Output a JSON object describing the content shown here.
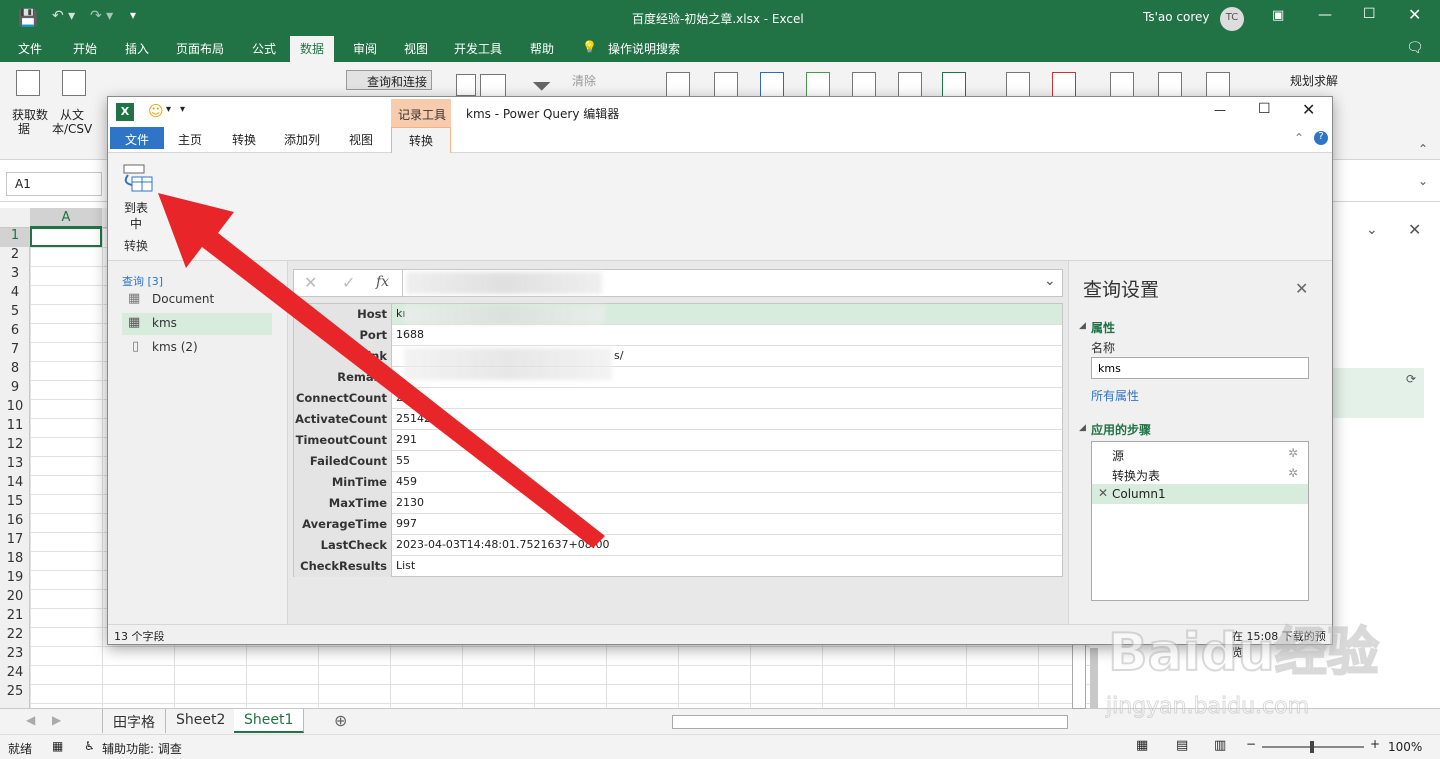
{
  "excel": {
    "title": "百度经验-初始之章.xlsx  -  Excel",
    "user": "Ts'ao corey",
    "user_initials": "TC",
    "tabs": [
      "文件",
      "开始",
      "插入",
      "页面布局",
      "公式",
      "数据",
      "审阅",
      "视图",
      "开发工具",
      "帮助",
      "操作说明搜索"
    ],
    "active_tab": "数据",
    "ribbon": {
      "get_data": "获取数",
      "get_data2": "据",
      "from_csv": "从文",
      "from_csv2": "本/CSV",
      "queries_connections": "查询和连接",
      "clear": "清除",
      "solver": "规划求解"
    },
    "name_box": "A1",
    "column_a": "A",
    "rows": [
      "1",
      "2",
      "3",
      "4",
      "5",
      "6",
      "7",
      "8",
      "9",
      "10",
      "11",
      "12",
      "13",
      "14",
      "15",
      "16",
      "17",
      "18",
      "19",
      "20",
      "21",
      "22",
      "23",
      "24",
      "25"
    ],
    "sheets": [
      "田字格",
      "Sheet2",
      "Sheet1"
    ],
    "active_sheet": "Sheet1",
    "status_ready": "就绪",
    "status_accessibility": "辅助功能: 调查",
    "zoom": "100%"
  },
  "pq": {
    "title": "kms - Power Query 编辑器",
    "context_group": "记录工具",
    "tabs": [
      "文件",
      "主页",
      "转换",
      "添加列",
      "视图",
      "转换"
    ],
    "ribbon": {
      "to_table": "到表",
      "to_table2": "中",
      "group": "转换"
    },
    "queries_header": "查询 [3]",
    "queries": [
      "Document",
      "kms",
      "kms (2)"
    ],
    "selected_query": "kms",
    "formula_prefix": "fx",
    "record": [
      {
        "key": "Host",
        "value": "kı"
      },
      {
        "key": "Port",
        "value": "1688"
      },
      {
        "key": "Link",
        "value": "s/"
      },
      {
        "key": "Remark",
        "value": ""
      },
      {
        "key": "ConnectCount",
        "value": "25"
      },
      {
        "key": "ActivateCount",
        "value": "25142"
      },
      {
        "key": "TimeoutCount",
        "value": "291"
      },
      {
        "key": "FailedCount",
        "value": "55"
      },
      {
        "key": "MinTime",
        "value": "459"
      },
      {
        "key": "MaxTime",
        "value": "2130"
      },
      {
        "key": "AverageTime",
        "value": "997"
      },
      {
        "key": "LastCheck",
        "value": "2023-04-03T14:48:01.7521637+08:00"
      },
      {
        "key": "CheckResults",
        "value": "List"
      }
    ],
    "settings": {
      "title": "查询设置",
      "properties": "属性",
      "name_label": "名称",
      "name_value": "kms",
      "all_properties": "所有属性",
      "applied_steps": "应用的步骤",
      "steps": [
        "源",
        "转换为表",
        "Column1"
      ]
    },
    "status_left": "13 个字段",
    "status_right": "在 15:08 下载的预览"
  },
  "watermark": {
    "brand": "Baidu经验",
    "url": "jingyan.baidu.com"
  },
  "colors": {
    "excel_green": "#217346",
    "arrow_red": "#e8262a",
    "pq_accent": "#f4a460"
  }
}
